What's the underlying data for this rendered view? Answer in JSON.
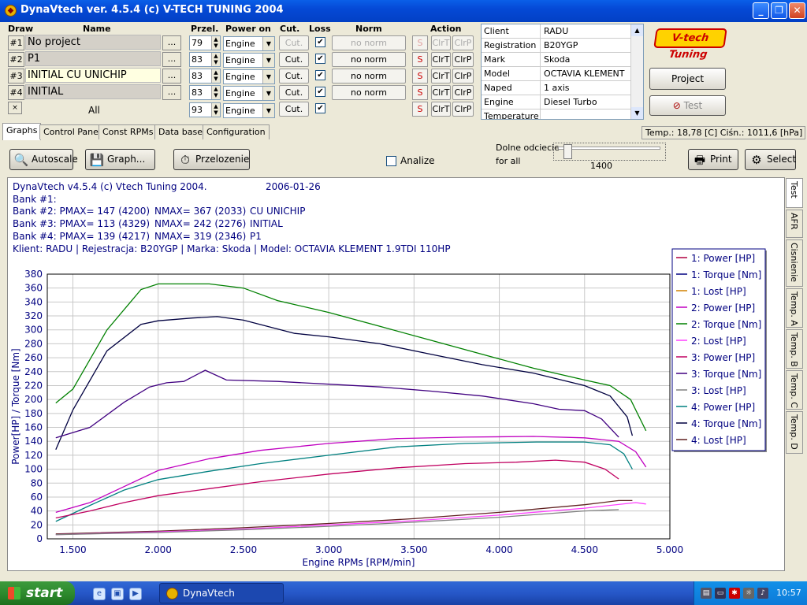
{
  "window": {
    "title": "DynaVtech ver. 4.5.4 (c) V-TECH TUNING 2004",
    "minimize_icon": "minimize-icon",
    "maximize_icon": "maximize-icon",
    "close_icon": "close-icon"
  },
  "headers": {
    "draw": "Draw",
    "name": "Name",
    "przel": "Przel.",
    "power_on": "Power on",
    "cut": "Cut.",
    "loss": "Loss",
    "norm": "Norm",
    "action": "Action"
  },
  "rows": [
    {
      "draw": "#1",
      "name": "No project",
      "przel": "79",
      "power_on": "Engine",
      "cut": "Cut.",
      "cut_enabled": false,
      "loss": true,
      "norm": "no norm",
      "norm_enabled": false,
      "s": "S",
      "clrt": "ClrT",
      "clrp": "ClrP",
      "actions_enabled": false
    },
    {
      "draw": "#2",
      "name": "P1",
      "przel": "83",
      "power_on": "Engine",
      "cut": "Cut.",
      "cut_enabled": true,
      "loss": true,
      "norm": "no norm",
      "norm_enabled": true,
      "s": "S",
      "clrt": "ClrT",
      "clrp": "ClrP",
      "actions_enabled": true
    },
    {
      "draw": "#3",
      "name": "INITIAL CU UNICHIP",
      "przel": "83",
      "power_on": "Engine",
      "cut": "Cut.",
      "cut_enabled": true,
      "loss": true,
      "norm": "no norm",
      "norm_enabled": true,
      "s": "S",
      "clrt": "ClrT",
      "clrp": "ClrP",
      "actions_enabled": true
    },
    {
      "draw": "#4",
      "name": "INITIAL",
      "przel": "83",
      "power_on": "Engine",
      "cut": "Cut.",
      "cut_enabled": true,
      "loss": true,
      "norm": "no norm",
      "norm_enabled": true,
      "s": "S",
      "clrt": "ClrT",
      "clrp": "ClrP",
      "actions_enabled": true
    }
  ],
  "all_row": {
    "draw": "×",
    "name": "All",
    "przel": "93",
    "power_on": "Engine",
    "cut": "Cut.",
    "loss": true,
    "s": "S",
    "clrt": "ClrT",
    "clrp": "ClrP"
  },
  "info": [
    {
      "key": "Client",
      "value": "RADU"
    },
    {
      "key": "Registration",
      "value": "B20YGP"
    },
    {
      "key": "Mark",
      "value": "Skoda"
    },
    {
      "key": "Model",
      "value": "OCTAVIA KLEMENT"
    },
    {
      "key": "Naped",
      "value": "1 axis"
    },
    {
      "key": "Engine",
      "value": "Diesel Turbo"
    },
    {
      "key": "Temperature",
      "value": ""
    }
  ],
  "logo": "V-tech Tuning",
  "buttons": {
    "project": "Project",
    "test": "Test"
  },
  "tabs": [
    "Graphs",
    "Control Panel",
    "Const RPMs",
    "Data base",
    "Configuration"
  ],
  "status": "Temp.: 18,78 [C]  Ciśn.: 1011,6 [hPa]",
  "toolbar": {
    "autoscale": "Autoscale",
    "graph": "Graph...",
    "przelozenie": "Przelozenie",
    "analize": "Analize",
    "dolne1": "Dolne odciecie",
    "dolne2": "for all",
    "slider_value": "1400",
    "slider_fraction": 0.07,
    "print": "Print",
    "select": "Select"
  },
  "side_tabs": [
    "Test",
    "AFR",
    "Cisnienie",
    "Temp. A",
    "Temp. B",
    "Temp. C",
    "Temp. D"
  ],
  "taskbar": {
    "start": "start",
    "app": "DynaVtech",
    "clock": "10:57"
  },
  "chart_info": {
    "line1": "DynaVtech v4.5.4 (c) Vtech Tuning 2004.",
    "date": "2006-01-26",
    "bank1": "Bank #1:",
    "bank2": "Bank #2: PMAX= 147 (4200)",
    "bank2n": "NMAX= 367 (2033)",
    "bank2name": "CU UNICHIP",
    "bank3": "Bank #3: PMAX= 113 (4329)",
    "bank3n": "NMAX= 242 (2276)",
    "bank3name": "INITIAL",
    "bank4": "Bank #4: PMAX= 139 (4217)",
    "bank4n": "NMAX= 319 (2346)",
    "bank4name": "P1",
    "client_line": "Klient: RADU | Rejestracja: B20YGP | Marka: Skoda | Model: OCTAVIA KLEMENT 1.9TDI 110HP"
  },
  "chart_data": {
    "type": "line",
    "xlabel": "Engine RPMs [RPM/min]",
    "ylabel": "Power[HP] / Torque [Nm]",
    "xlim": [
      1350,
      5000
    ],
    "ylim": [
      0,
      380
    ],
    "x_ticks": [
      "1.500",
      "2.000",
      "2.500",
      "3.000",
      "3.500",
      "4.000",
      "4.500",
      "5.000"
    ],
    "x_tick_values": [
      1500,
      2000,
      2500,
      3000,
      3500,
      4000,
      4500,
      5000
    ],
    "y_ticks": [
      0,
      20,
      40,
      60,
      80,
      100,
      120,
      140,
      160,
      180,
      200,
      220,
      240,
      260,
      280,
      300,
      320,
      340,
      360,
      380
    ],
    "grid": true,
    "legend_position": "right",
    "legend": [
      {
        "name": "1: Power [HP]",
        "color": "#b00040"
      },
      {
        "name": "1: Torque [Nm]",
        "color": "#000080"
      },
      {
        "name": "1: Lost [HP]",
        "color": "#d08000"
      },
      {
        "name": "2: Power [HP]",
        "color": "#c000c0"
      },
      {
        "name": "2: Torque [Nm]",
        "color": "#008000"
      },
      {
        "name": "2: Lost [HP]",
        "color": "#ff40ff"
      },
      {
        "name": "3: Power [HP]",
        "color": "#c00060"
      },
      {
        "name": "3: Torque [Nm]",
        "color": "#400080"
      },
      {
        "name": "3: Lost [HP]",
        "color": "#808080"
      },
      {
        "name": "4: Power [HP]",
        "color": "#008080"
      },
      {
        "name": "4: Torque [Nm]",
        "color": "#000040"
      },
      {
        "name": "4: Lost [HP]",
        "color": "#602020"
      }
    ],
    "series": [
      {
        "legend_index": 4,
        "x": [
          1400,
          1500,
          1700,
          1900,
          2000,
          2100,
          2300,
          2500,
          2700,
          3000,
          3300,
          3600,
          3900,
          4200,
          4500,
          4650,
          4770,
          4860
        ],
        "y": [
          195,
          215,
          300,
          358,
          366,
          366,
          366,
          360,
          342,
          325,
          305,
          285,
          265,
          245,
          228,
          220,
          200,
          155
        ]
      },
      {
        "legend_index": 10,
        "x": [
          1400,
          1500,
          1700,
          1900,
          2000,
          2200,
          2346,
          2500,
          2800,
          3000,
          3300,
          3600,
          3900,
          4200,
          4500,
          4650,
          4750,
          4780
        ],
        "y": [
          128,
          185,
          270,
          308,
          313,
          317,
          319,
          314,
          295,
          290,
          280,
          265,
          250,
          238,
          220,
          205,
          175,
          148
        ]
      },
      {
        "legend_index": 7,
        "x": [
          1400,
          1600,
          1800,
          1950,
          2050,
          2150,
          2276,
          2400,
          2700,
          3000,
          3300,
          3600,
          3900,
          4200,
          4350,
          4500,
          4600,
          4700
        ],
        "y": [
          145,
          160,
          196,
          218,
          224,
          226,
          242,
          228,
          226,
          222,
          218,
          212,
          205,
          194,
          186,
          184,
          172,
          146
        ]
      },
      {
        "legend_index": 3,
        "x": [
          1400,
          1600,
          1800,
          2000,
          2300,
          2600,
          3000,
          3400,
          3800,
          4200,
          4500,
          4700,
          4800,
          4860
        ],
        "y": [
          38,
          52,
          75,
          98,
          115,
          127,
          137,
          144,
          146,
          147,
          145,
          140,
          125,
          103
        ]
      },
      {
        "legend_index": 9,
        "x": [
          1400,
          1600,
          1800,
          2000,
          2300,
          2600,
          3000,
          3400,
          3800,
          4217,
          4500,
          4650,
          4730,
          4780
        ],
        "y": [
          25,
          48,
          70,
          85,
          97,
          108,
          120,
          132,
          137,
          139,
          139,
          135,
          122,
          100
        ]
      },
      {
        "legend_index": 6,
        "x": [
          1400,
          1600,
          1800,
          2000,
          2300,
          2600,
          3000,
          3400,
          3800,
          4100,
          4329,
          4500,
          4620,
          4700
        ],
        "y": [
          30,
          40,
          52,
          62,
          72,
          82,
          93,
          102,
          108,
          110,
          113,
          110,
          100,
          86
        ]
      },
      {
        "legend_index": 11,
        "x": [
          1400,
          2000,
          2500,
          3000,
          3500,
          4000,
          4500,
          4700,
          4780
        ],
        "y": [
          7,
          11,
          16,
          22,
          29,
          38,
          49,
          55,
          55
        ]
      },
      {
        "legend_index": 5,
        "x": [
          1400,
          2000,
          2500,
          3000,
          3500,
          4000,
          4500,
          4800,
          4860
        ],
        "y": [
          6,
          10,
          14,
          20,
          26,
          34,
          44,
          52,
          50
        ]
      },
      {
        "legend_index": 8,
        "x": [
          1400,
          2000,
          2500,
          3000,
          3500,
          4000,
          4500,
          4700
        ],
        "y": [
          6,
          9,
          13,
          18,
          24,
          31,
          40,
          42
        ]
      }
    ]
  }
}
